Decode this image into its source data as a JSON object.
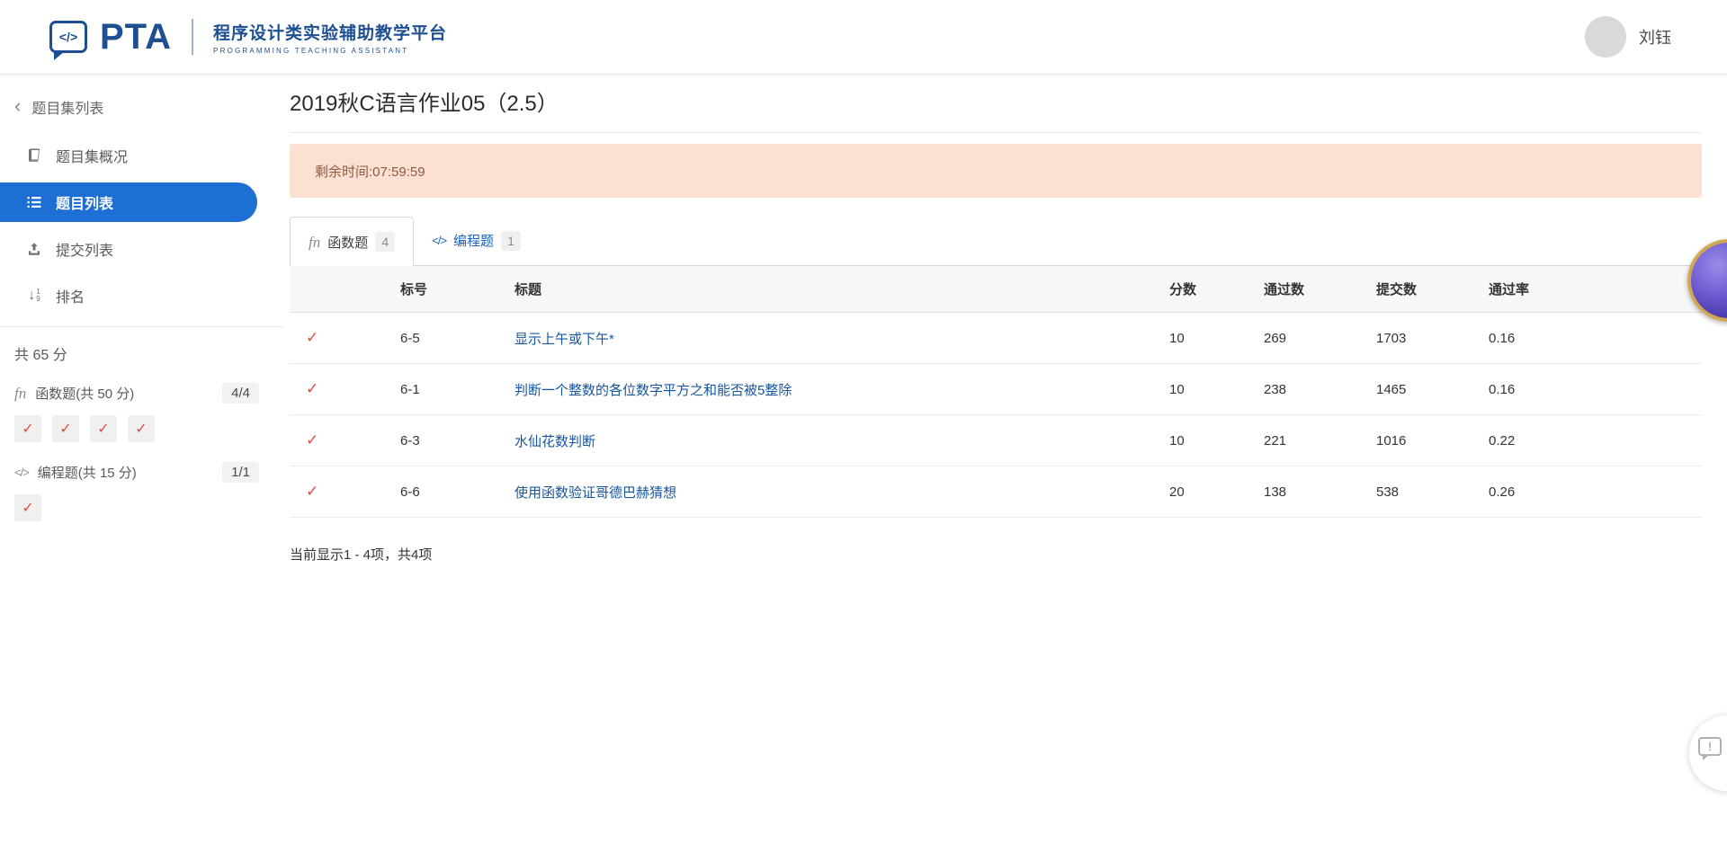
{
  "header": {
    "logo": {
      "icon_text": "</>",
      "brand": "PTA",
      "title_cn": "程序设计类实验辅助教学平台",
      "title_en": "PROGRAMMING TEACHING ASSISTANT"
    },
    "user": {
      "name": "刘钰"
    }
  },
  "sidebar": {
    "back_label": "题目集列表",
    "items": [
      {
        "label": "题目集概况"
      },
      {
        "label": "题目列表"
      },
      {
        "label": "提交列表"
      },
      {
        "label": "排名"
      }
    ],
    "summary": {
      "total": "共 65 分",
      "groups": [
        {
          "label": "函数题(共 50 分)",
          "badge": "4/4"
        },
        {
          "label": "编程题(共 15 分)",
          "badge": "1/1"
        }
      ]
    }
  },
  "main": {
    "title": "2019秋C语言作业05（2.5）",
    "notice": "剩余时间:07:59:59",
    "tabs": [
      {
        "label": "函数题",
        "badge": "4"
      },
      {
        "label": "编程题",
        "badge": "1"
      }
    ],
    "table": {
      "headers": [
        "",
        "标号",
        "标题",
        "分数",
        "通过数",
        "提交数",
        "通过率"
      ],
      "rows": [
        {
          "status": "✓",
          "id": "6-5",
          "title": "显示上午或下午*",
          "score": "10",
          "accepted": "269",
          "submissions": "1703",
          "rate": "0.16"
        },
        {
          "status": "✓",
          "id": "6-1",
          "title": "判断一个整数的各位数字平方之和能否被5整除",
          "score": "10",
          "accepted": "238",
          "submissions": "1465",
          "rate": "0.16"
        },
        {
          "status": "✓",
          "id": "6-3",
          "title": "水仙花数判断",
          "score": "10",
          "accepted": "221",
          "submissions": "1016",
          "rate": "0.22"
        },
        {
          "status": "✓",
          "id": "6-6",
          "title": "使用函数验证哥德巴赫猜想",
          "score": "20",
          "accepted": "138",
          "submissions": "538",
          "rate": "0.26"
        }
      ],
      "footer": "当前显示1 - 4项，共4项"
    }
  },
  "icons": {
    "back": "‹",
    "check": "✓",
    "fn": "fn",
    "code": "</>",
    "sort_arrow": "↓",
    "sort_top": "1",
    "sort_bottom": "9"
  },
  "colors": {
    "brand_navy": "#1d4f91",
    "primary_blue": "#1d6fd3",
    "link_blue": "#17559f",
    "check_red": "#e8483d",
    "banner_bg": "#fce0d2",
    "banner_text": "#8a5a42"
  }
}
